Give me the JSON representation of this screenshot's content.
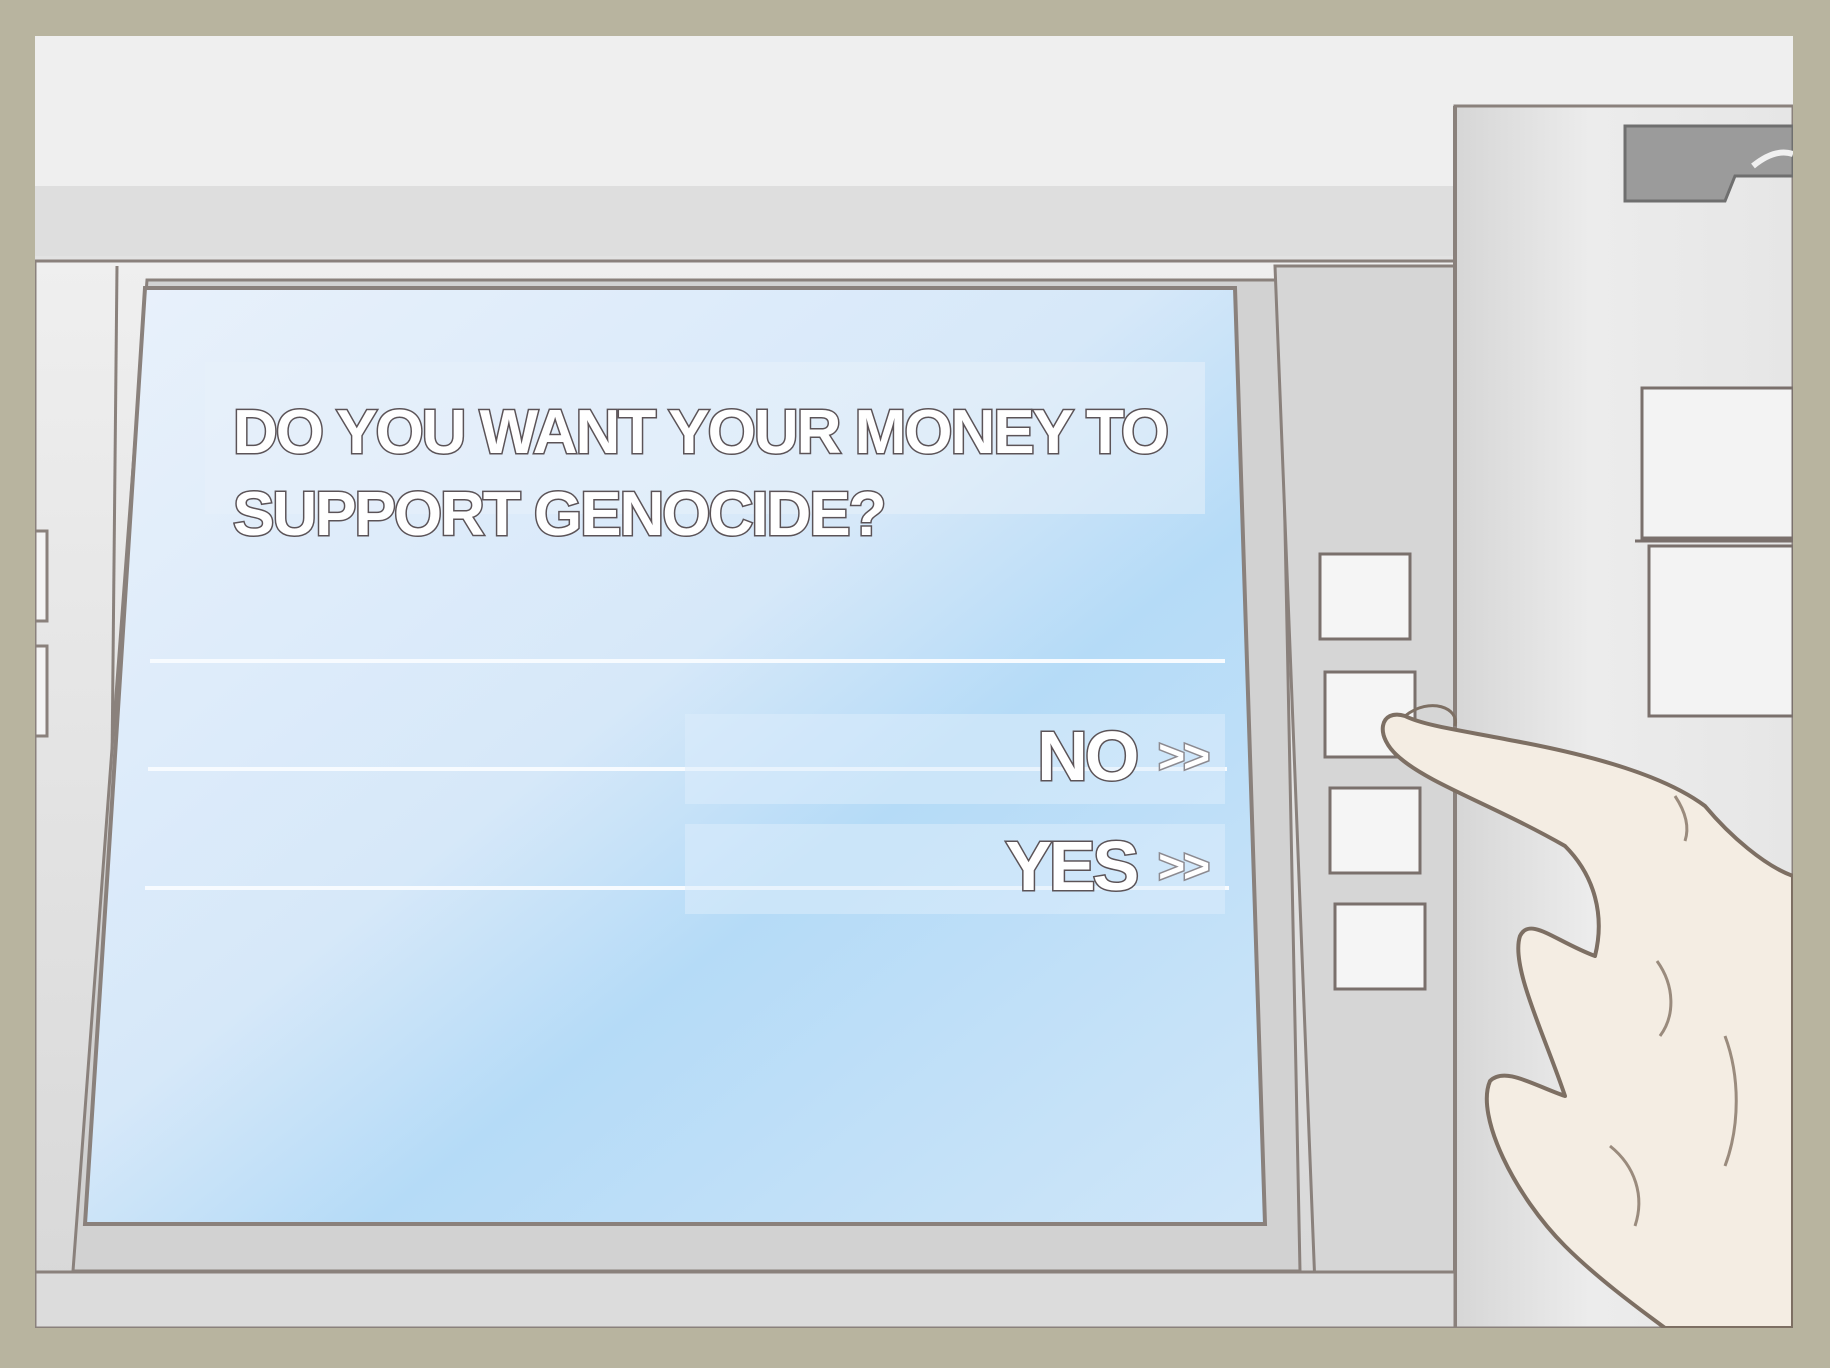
{
  "screen": {
    "question": "DO YOU WANT YOUR MONEY TO SUPPORT GENOCIDE?",
    "options": [
      {
        "label": "NO",
        "arrow": ">>"
      },
      {
        "label": "YES",
        "arrow": ">>"
      }
    ]
  },
  "colors": {
    "frame": "#b8b49f",
    "screen_light": "#e2ecf8",
    "screen_blue": "#a8d4f6",
    "text_outline": "#5b5357",
    "skin": "#f2e8dc"
  },
  "icons": {
    "side_keys": "atm-side-key-icon",
    "card_slot": "card-slot-icon",
    "hand": "pointing-hand-icon"
  }
}
